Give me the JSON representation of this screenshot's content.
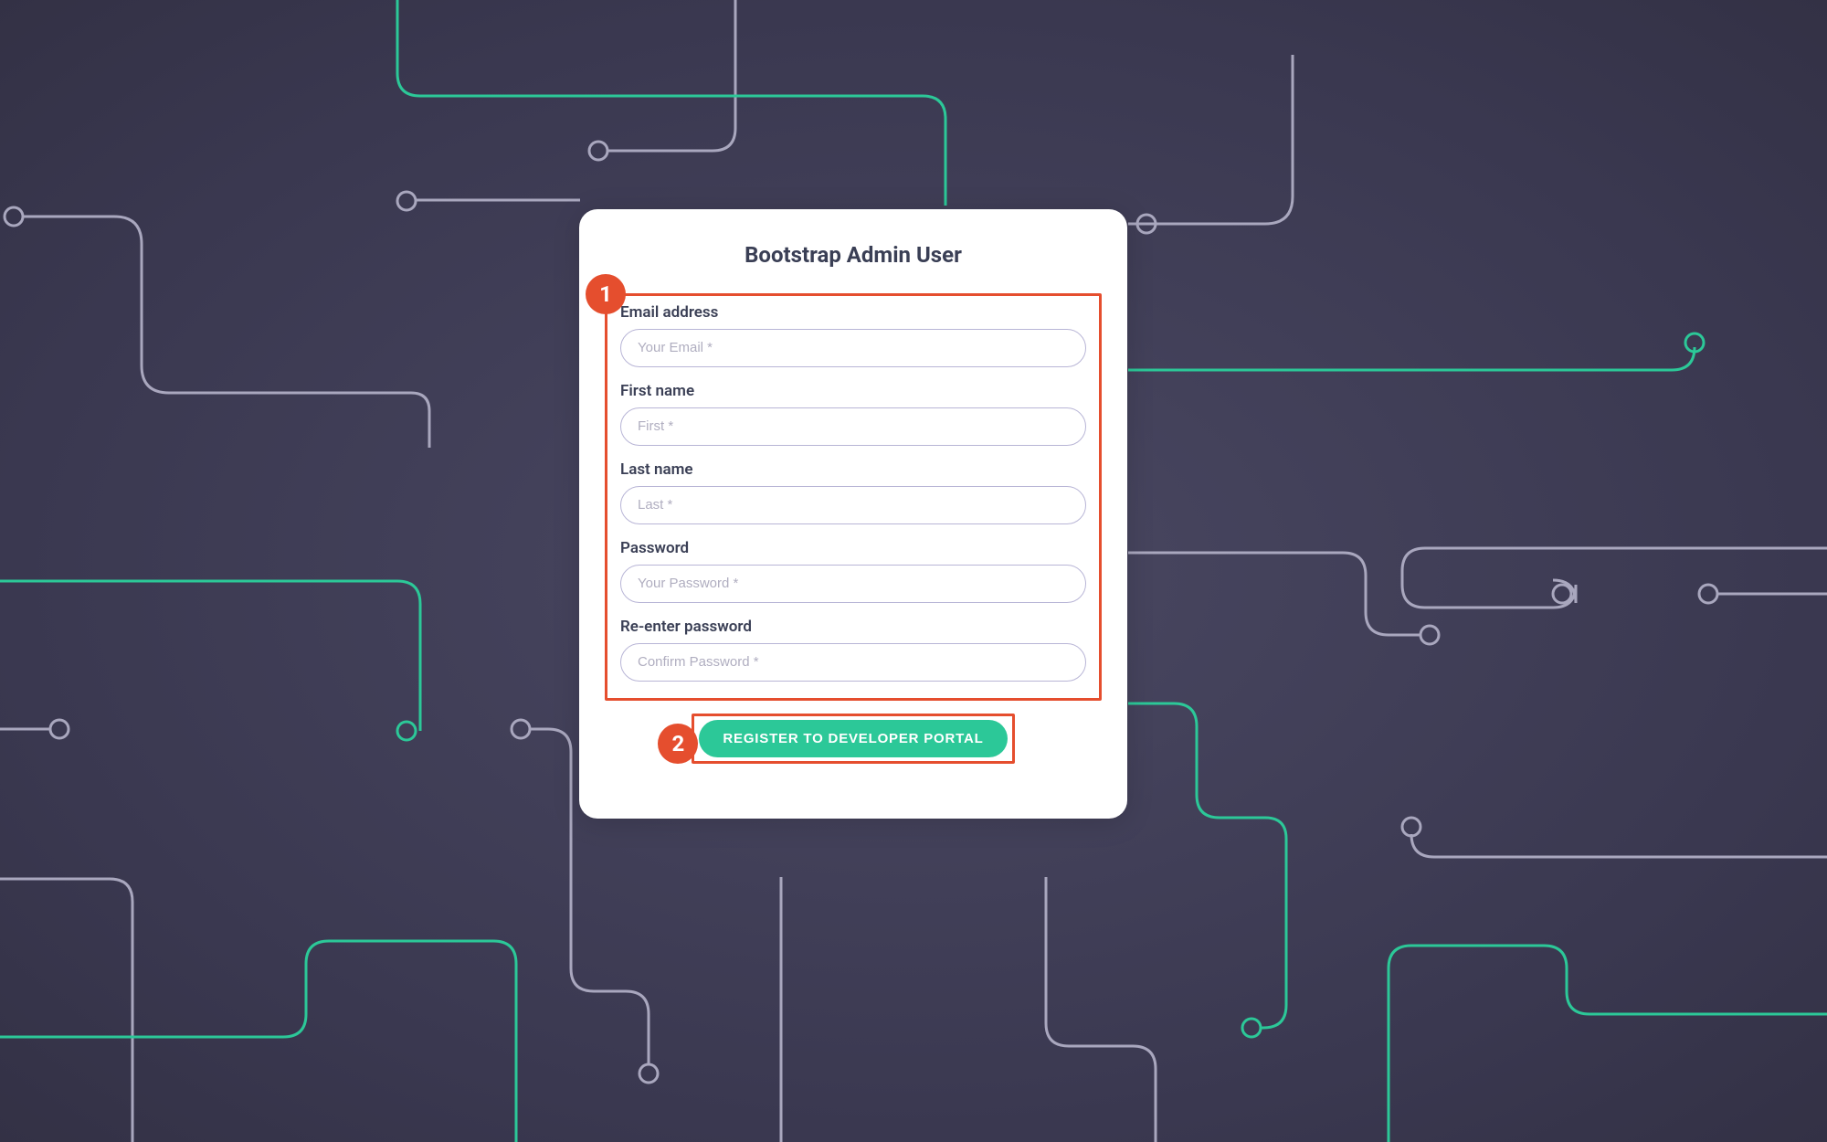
{
  "card": {
    "title": "Bootstrap Admin User"
  },
  "form": {
    "email": {
      "label": "Email address",
      "placeholder": "Your Email *"
    },
    "first": {
      "label": "First name",
      "placeholder": "First *"
    },
    "last": {
      "label": "Last name",
      "placeholder": "Last *"
    },
    "password": {
      "label": "Password",
      "placeholder": "Your Password *"
    },
    "confirm": {
      "label": "Re-enter password",
      "placeholder": "Confirm Password *"
    }
  },
  "button": {
    "register": "REGISTER TO DEVELOPER PORTAL"
  },
  "callouts": {
    "one": "1",
    "two": "2"
  }
}
